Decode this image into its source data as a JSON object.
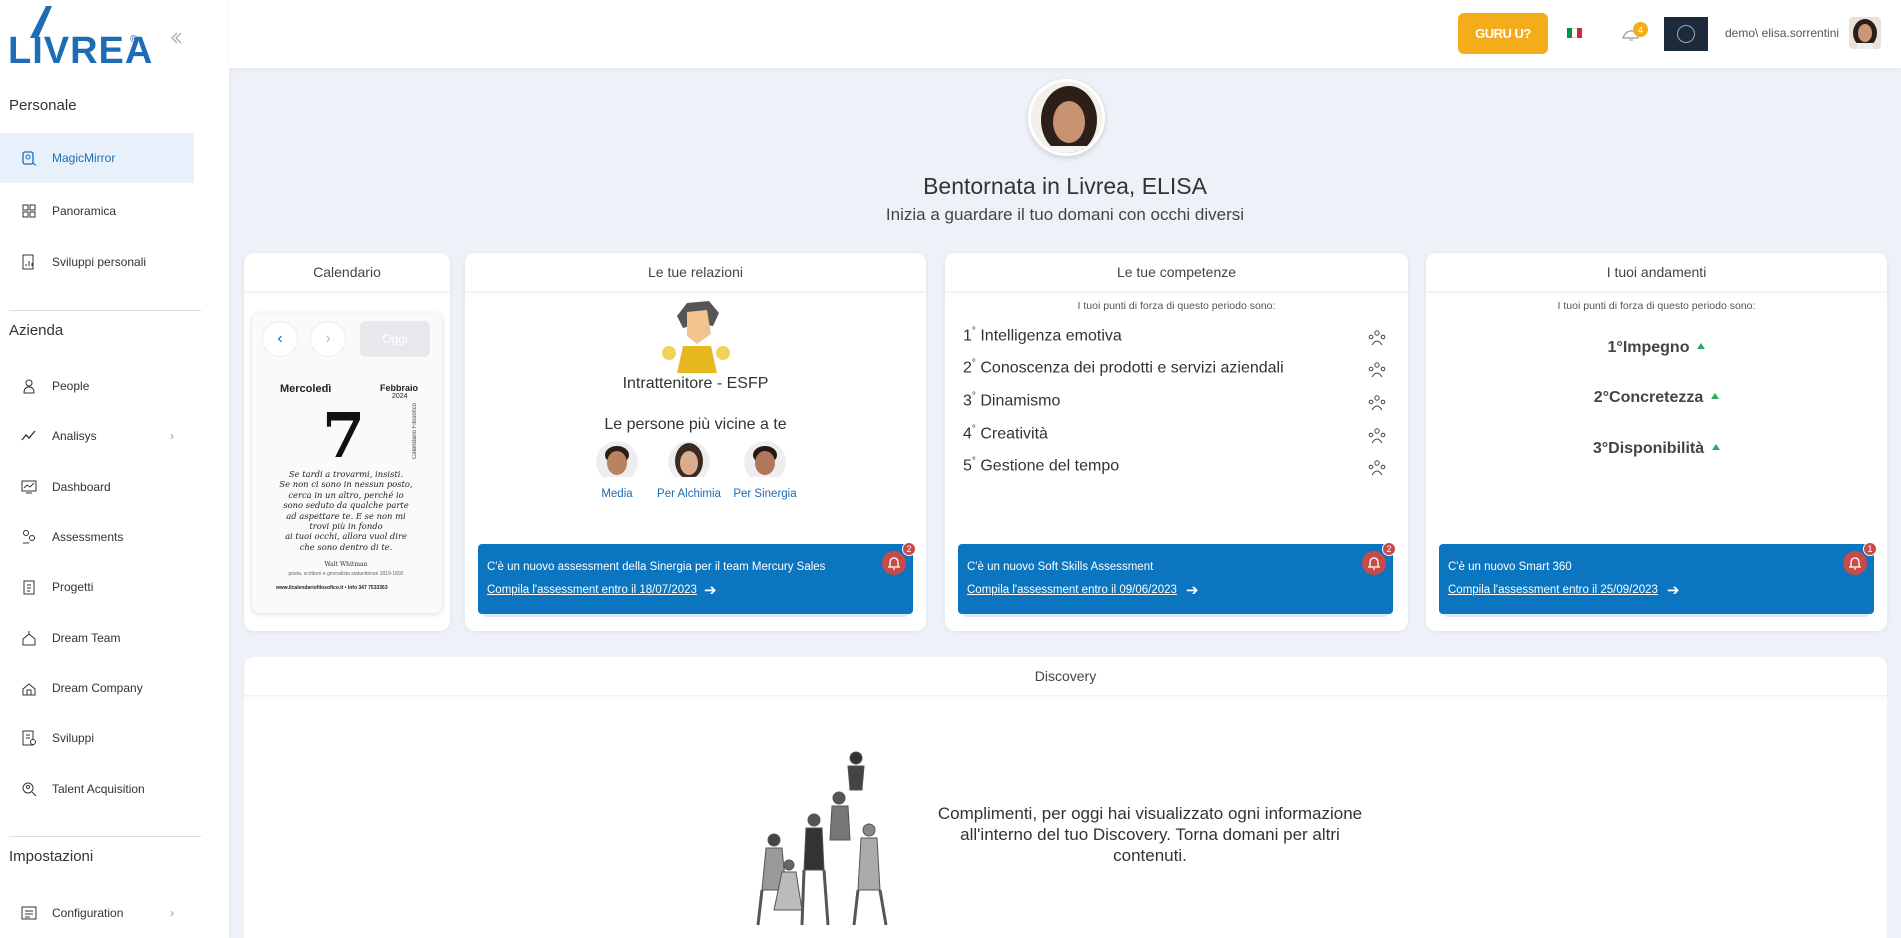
{
  "sidebar": {
    "logo_text": "LIVREA",
    "logo_reg": "®",
    "collapse_glyph": "⟨⟨",
    "sections": {
      "personale": "Personale",
      "azienda": "Azienda",
      "impostazioni": "Impostazioni"
    },
    "items": [
      {
        "label": "MagicMirror",
        "icon": "magic-mirror-icon",
        "active": true
      },
      {
        "label": "Panoramica",
        "icon": "dashboard-grid-icon"
      },
      {
        "label": "Sviluppi personali",
        "icon": "document-chart-icon"
      },
      {
        "label": "People",
        "icon": "person-icon"
      },
      {
        "label": "Analisys",
        "icon": "analytics-icon",
        "has_children": true
      },
      {
        "label": "Dashboard",
        "icon": "chart-screen-icon"
      },
      {
        "label": "Assessments",
        "icon": "assessment-icon"
      },
      {
        "label": "Progetti",
        "icon": "clipboard-icon"
      },
      {
        "label": "Dream Team",
        "icon": "team-icon"
      },
      {
        "label": "Dream Company",
        "icon": "company-icon"
      },
      {
        "label": "Sviluppi",
        "icon": "development-icon"
      },
      {
        "label": "Talent Acquisition",
        "icon": "talent-search-icon"
      },
      {
        "label": "Configuration",
        "icon": "configuration-icon",
        "has_children": true
      }
    ],
    "chevron": "›"
  },
  "topbar": {
    "guru_label": "GURU U?",
    "notification_count": "4",
    "username": "demo\\ elisa.sorrentini",
    "flag_colors": [
      "#009246",
      "#ffffff",
      "#ce2b37"
    ]
  },
  "hero": {
    "title": "Bentornata in Livrea, ELISA",
    "subtitle": "Inizia a guardare il tuo domani con occhi diversi"
  },
  "calendar": {
    "title": "Calendario",
    "prev": "‹",
    "next": "›",
    "today_label": "Oggi",
    "weekday": "Mercoledì",
    "month": "Febbraio",
    "year": "2024",
    "day_number": "7",
    "side_text": "Calendario Filosofico",
    "quote": "Se tardi a trovarmi, insisti.\nSe non ci sono in nessun posto,\ncerca in un altro, perché io\nsono seduto da qualche parte\nad aspettare te. E se non mi\ntrovi più in fondo\nai tuoi occhi, allora vuol dire\nche sono dentro di te.",
    "author": "Walt Whitman",
    "author_note": "poeta, scrittore e giornalista statunitense 1819-1892",
    "footer": "www.ilcalendariofilosofico.it   •   Info 347 7533363"
  },
  "relazioni": {
    "title": "Le tue relazioni",
    "personality": "Intrattenitore - ESFP",
    "closest_title": "Le persone più vicine a te",
    "people": [
      {
        "label": "Media"
      },
      {
        "label": "Per Alchimia"
      },
      {
        "label": "Per Sinergia"
      }
    ],
    "banner": {
      "text": "C'è un nuovo assessment della Sinergia per il team Mercury Sales",
      "link": "Compila l'assessment entro il 18/07/2023",
      "badge": "2"
    }
  },
  "competenze": {
    "title": "Le tue competenze",
    "kicker": "I tuoi punti di forza di questo periodo sono:",
    "items": [
      {
        "rank": "1",
        "label": "Intelligenza emotiva"
      },
      {
        "rank": "2",
        "label": "Conoscenza dei prodotti e servizi aziendali"
      },
      {
        "rank": "3",
        "label": "Dinamismo"
      },
      {
        "rank": "4",
        "label": "Creatività"
      },
      {
        "rank": "5",
        "label": "Gestione del tempo"
      }
    ],
    "degree": "°",
    "banner": {
      "text": "C'è un nuovo Soft Skills Assessment",
      "link": "Compila l'assessment entro il 09/06/2023",
      "badge": "2"
    }
  },
  "andamenti": {
    "title": "I tuoi andamenti",
    "kicker": "I tuoi punti di forza di questo periodo sono:",
    "items": [
      {
        "rank": "1°",
        "label": "Impegno"
      },
      {
        "rank": "2°",
        "label": "Concretezza"
      },
      {
        "rank": "3°",
        "label": "Disponibilità"
      }
    ],
    "banner": {
      "text": "C'è un nuovo Smart 360",
      "link": "Compila l'assessment entro il 25/09/2023",
      "badge": "1"
    }
  },
  "discovery": {
    "title": "Discovery",
    "message": "Complimenti, per oggi hai visualizzato ogni informazione all'interno del tuo Discovery. Torna domani per altri contenuti."
  },
  "arrow": "➔"
}
